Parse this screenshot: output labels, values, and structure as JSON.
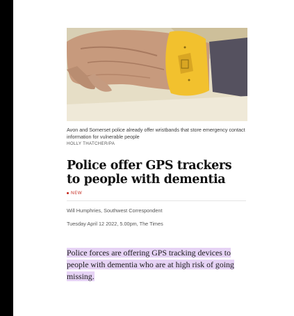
{
  "article": {
    "image": {
      "caption": "Avon and Somerset police already offer wristbands that store emergency contact information for vulnerable people",
      "credit": "HOLLY THATCHER/PA",
      "colors": {
        "wristband": "#f2c12e",
        "skin": "#c79a7d",
        "background": "#d9cfb3",
        "sleeve": "#55515f"
      }
    },
    "headline": "Police offer GPS trackers to people with dementia",
    "badge": "NEW",
    "byline": "Will Humphries, Southwest Correspondent",
    "dateline": "Tuesday April 12 2022, 5.00pm, The Times",
    "standfirst": "Police forces are offering GPS tracking devices to people with dementia who are at high risk of going missing.",
    "colors": {
      "badge": "#c4271c",
      "highlight": "#e6d3f5"
    }
  }
}
